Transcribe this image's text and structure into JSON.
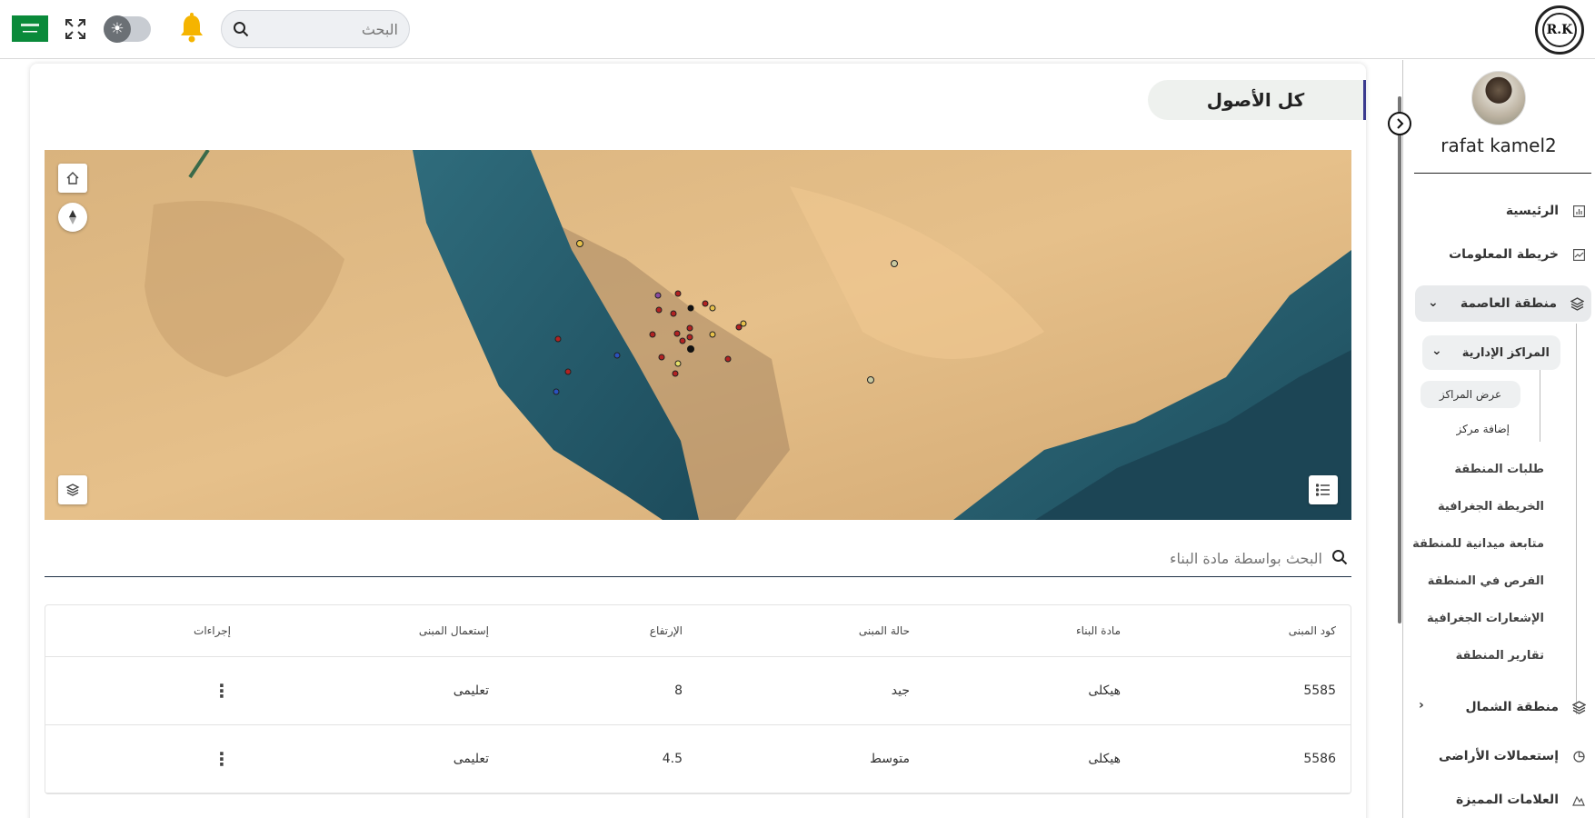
{
  "topbar": {
    "logo_text": "R.K",
    "flag_label": "Saudi flag",
    "search_placeholder": "البحث",
    "icons": {
      "search": "search-icon",
      "bell": "bell-icon",
      "theme": "sun-icon",
      "expand": "expand-icon"
    }
  },
  "sidebar": {
    "username": "rafat kamel2",
    "items": [
      {
        "label": "الرئيسية",
        "icon": "chart-icon"
      },
      {
        "label": "خريطة المعلومات",
        "icon": "map-icon"
      },
      {
        "label": "منطقة العاصمة",
        "icon": "layers-icon"
      },
      {
        "label": "منطقة الشمال",
        "icon": "layers-icon"
      },
      {
        "label": "إستعمالات الأراضى",
        "icon": "pie-icon"
      },
      {
        "label": "العلامات المميزة",
        "icon": "landmark-icon"
      }
    ],
    "capital_sub": {
      "group_label": "المراكز الإدارية",
      "group_children": [
        "عرض المراكز",
        "إضافة مركز"
      ],
      "items": [
        "طلبات المنطقة",
        "الخريطة الجغرافية",
        "متابعة ميدانية للمنطقة",
        "الفرص في المنطقة",
        "الإشعارات الجغرافية",
        "تقارير المنطقة"
      ]
    }
  },
  "main": {
    "title": "كل الأصول",
    "table_search_placeholder": "البحث بواسطة مادة البناء",
    "columns": [
      "كود المبنى",
      "مادة البناء",
      "حالة المبنى",
      "الإرتفاع",
      "إستعمال المبنى",
      "إجراءات"
    ],
    "rows": [
      {
        "code": "5585",
        "material": "هيكلى",
        "status": "جيد",
        "height": "8",
        "usage": "تعليمى",
        "action": "⋮"
      },
      {
        "code": "5586",
        "material": "هيكلى",
        "status": "متوسط",
        "height": "4.5",
        "usage": "تعليمى",
        "action": "⋮"
      }
    ]
  },
  "colors": {
    "accent": "#3b3a8e",
    "marker_red": "#b22222",
    "marker_yellow": "#e6c04a",
    "marker_blue": "#2a52be",
    "marker_black": "#111111"
  }
}
